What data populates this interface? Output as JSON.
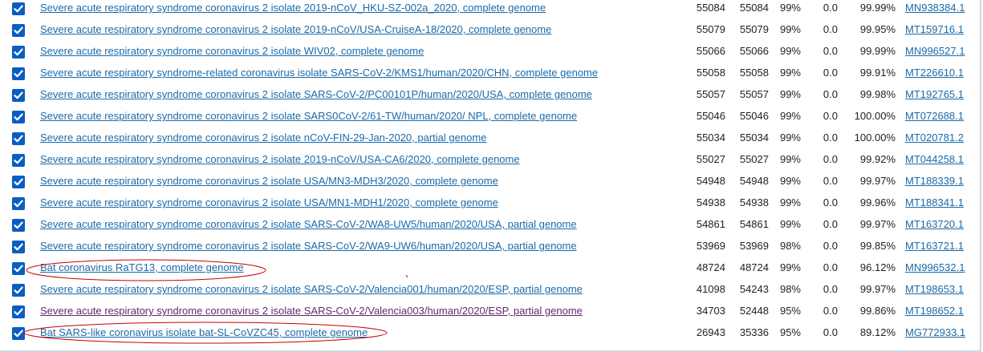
{
  "results": {
    "rows": [
      {
        "description": "Severe acute respiratory syndrome coronavirus 2 isolate 2019-nCoV_HKU-SZ-002a_2020, complete genome",
        "max_score": "55084",
        "total_score": "55084",
        "query_cover": "99%",
        "e_value": "0.0",
        "per_ident": "99.99%",
        "accession": "MN938384.1",
        "visited": false
      },
      {
        "description": "Severe acute respiratory syndrome coronavirus 2 isolate 2019-nCoV/USA-CruiseA-18/2020, complete genome",
        "max_score": "55079",
        "total_score": "55079",
        "query_cover": "99%",
        "e_value": "0.0",
        "per_ident": "99.95%",
        "accession": "MT159716.1",
        "visited": false
      },
      {
        "description": "Severe acute respiratory syndrome coronavirus 2 isolate WIV02, complete genome",
        "max_score": "55066",
        "total_score": "55066",
        "query_cover": "99%",
        "e_value": "0.0",
        "per_ident": "99.99%",
        "accession": "MN996527.1",
        "visited": false
      },
      {
        "description": "Severe acute respiratory syndrome-related coronavirus isolate SARS-CoV-2/KMS1/human/2020/CHN, complete genome",
        "max_score": "55058",
        "total_score": "55058",
        "query_cover": "99%",
        "e_value": "0.0",
        "per_ident": "99.91%",
        "accession": "MT226610.1",
        "visited": false
      },
      {
        "description": "Severe acute respiratory syndrome coronavirus 2 isolate SARS-CoV-2/PC00101P/human/2020/USA, complete genome",
        "max_score": "55057",
        "total_score": "55057",
        "query_cover": "99%",
        "e_value": "0.0",
        "per_ident": "99.98%",
        "accession": "MT192765.1",
        "visited": false
      },
      {
        "description": "Severe acute respiratory syndrome coronavirus 2 isolate SARS0CoV-2/61-TW/human/2020/ NPL, complete genome",
        "max_score": "55046",
        "total_score": "55046",
        "query_cover": "99%",
        "e_value": "0.0",
        "per_ident": "100.00%",
        "accession": "MT072688.1",
        "visited": false
      },
      {
        "description": "Severe acute respiratory syndrome coronavirus 2 isolate nCoV-FIN-29-Jan-2020, partial genome",
        "max_score": "55034",
        "total_score": "55034",
        "query_cover": "99%",
        "e_value": "0.0",
        "per_ident": "100.00%",
        "accession": "MT020781.2",
        "visited": false
      },
      {
        "description": "Severe acute respiratory syndrome coronavirus 2 isolate 2019-nCoV/USA-CA6/2020, complete genome",
        "max_score": "55027",
        "total_score": "55027",
        "query_cover": "99%",
        "e_value": "0.0",
        "per_ident": "99.92%",
        "accession": "MT044258.1",
        "visited": false
      },
      {
        "description": "Severe acute respiratory syndrome coronavirus 2 isolate USA/MN3-MDH3/2020, complete genome",
        "max_score": "54948",
        "total_score": "54948",
        "query_cover": "99%",
        "e_value": "0.0",
        "per_ident": "99.97%",
        "accession": "MT188339.1",
        "visited": false
      },
      {
        "description": "Severe acute respiratory syndrome coronavirus 2 isolate USA/MN1-MDH1/2020, complete genome",
        "max_score": "54938",
        "total_score": "54938",
        "query_cover": "99%",
        "e_value": "0.0",
        "per_ident": "99.96%",
        "accession": "MT188341.1",
        "visited": false
      },
      {
        "description": "Severe acute respiratory syndrome coronavirus 2 isolate SARS-CoV-2/WA8-UW5/human/2020/USA, partial genome",
        "max_score": "54861",
        "total_score": "54861",
        "query_cover": "99%",
        "e_value": "0.0",
        "per_ident": "99.97%",
        "accession": "MT163720.1",
        "visited": false
      },
      {
        "description": "Severe acute respiratory syndrome coronavirus 2 isolate SARS-CoV-2/WA9-UW6/human/2020/USA, partial genome",
        "max_score": "53969",
        "total_score": "53969",
        "query_cover": "98%",
        "e_value": "0.0",
        "per_ident": "99.85%",
        "accession": "MT163721.1",
        "visited": false
      },
      {
        "description": "Bat coronavirus RaTG13, complete genome",
        "max_score": "48724",
        "total_score": "48724",
        "query_cover": "99%",
        "e_value": "0.0",
        "per_ident": "96.12%",
        "accession": "MN996532.1",
        "visited": false
      },
      {
        "description": "Severe acute respiratory syndrome coronavirus 2 isolate SARS-CoV-2/Valencia001/human/2020/ESP, partial genome",
        "max_score": "41098",
        "total_score": "54243",
        "query_cover": "98%",
        "e_value": "0.0",
        "per_ident": "99.97%",
        "accession": "MT198653.1",
        "visited": false
      },
      {
        "description": "Severe acute respiratory syndrome coronavirus 2 isolate SARS-CoV-2/Valencia003/human/2020/ESP, partial genome",
        "max_score": "34703",
        "total_score": "52448",
        "query_cover": "95%",
        "e_value": "0.0",
        "per_ident": "99.86%",
        "accession": "MT198652.1",
        "visited": true
      },
      {
        "description": "Bat SARS-like coronavirus isolate bat-SL-CoVZC45, complete genome",
        "max_score": "26943",
        "total_score": "35336",
        "query_cover": "95%",
        "e_value": "0.0",
        "per_ident": "89.12%",
        "accession": "MG772933.1",
        "visited": false
      }
    ]
  },
  "colors": {
    "link": "#1b6aa8",
    "visited_link": "#61286e",
    "checkbox": "#0a5dc2",
    "annotation": "#cc0000"
  }
}
